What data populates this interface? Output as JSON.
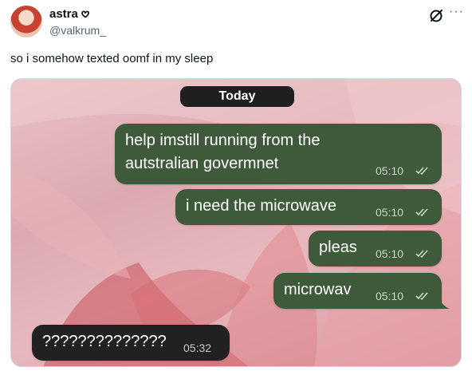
{
  "tweet": {
    "display_name": "astra 𖹭",
    "handle": "@valkrum_",
    "text": "so i somehow texted oomf in my sleep",
    "more_label": "···"
  },
  "chat": {
    "date_label": "Today",
    "messages": [
      {
        "direction": "out",
        "lines": [
          "help imstill running from the",
          "autstralian govermnet"
        ],
        "time": "05:10",
        "read": true
      },
      {
        "direction": "out",
        "lines": [
          "i need the microwave"
        ],
        "time": "05:10",
        "read": true
      },
      {
        "direction": "out",
        "lines": [
          "pleas"
        ],
        "time": "05:10",
        "read": true
      },
      {
        "direction": "out",
        "lines": [
          "microwav"
        ],
        "time": "05:10",
        "read": true
      },
      {
        "direction": "in",
        "lines": [
          "??????????????"
        ],
        "time": "05:32",
        "read": false
      }
    ]
  },
  "colors": {
    "outgoing_bubble": "#3e5a3b",
    "incoming_bubble": "#212121",
    "date_pill": "#1f1f1f",
    "handle_text": "#536471"
  },
  "icons": {
    "grok": "grok-icon",
    "more": "more-icon",
    "read_receipt": "double-check-icon"
  }
}
